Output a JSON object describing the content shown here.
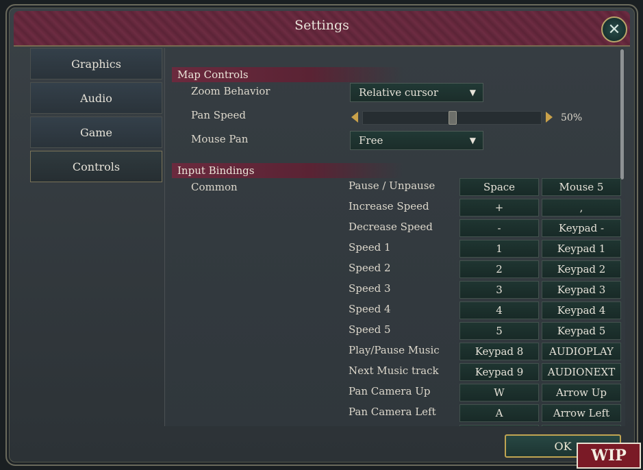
{
  "window": {
    "title": "Settings",
    "close_icon": "close-icon"
  },
  "tabs": [
    {
      "label": "Graphics"
    },
    {
      "label": "Audio"
    },
    {
      "label": "Game"
    },
    {
      "label": "Controls",
      "active": true
    }
  ],
  "map_controls": {
    "header": "Map Controls",
    "zoom_behavior": {
      "label": "Zoom Behavior",
      "value": "Relative cursor"
    },
    "pan_speed": {
      "label": "Pan Speed",
      "value": "50%",
      "fraction": 0.5
    },
    "mouse_pan": {
      "label": "Mouse Pan",
      "value": "Free"
    }
  },
  "input_bindings": {
    "header": "Input Bindings",
    "group": "Common",
    "rows": [
      {
        "action": "Pause / Unpause",
        "key1": "Space",
        "key2": "Mouse 5"
      },
      {
        "action": "Increase Speed",
        "key1": "+",
        "key2": ","
      },
      {
        "action": "Decrease Speed",
        "key1": "-",
        "key2": "Keypad -"
      },
      {
        "action": "Speed 1",
        "key1": "1",
        "key2": "Keypad 1"
      },
      {
        "action": "Speed 2",
        "key1": "2",
        "key2": "Keypad 2"
      },
      {
        "action": "Speed 3",
        "key1": "3",
        "key2": "Keypad 3"
      },
      {
        "action": "Speed 4",
        "key1": "4",
        "key2": "Keypad 4"
      },
      {
        "action": "Speed 5",
        "key1": "5",
        "key2": "Keypad 5"
      },
      {
        "action": "Play/Pause Music",
        "key1": "Keypad 8",
        "key2": "AUDIOPLAY"
      },
      {
        "action": "Next Music track",
        "key1": "Keypad 9",
        "key2": "AUDIONEXT"
      },
      {
        "action": "Pan Camera Up",
        "key1": "W",
        "key2": "Arrow Up"
      },
      {
        "action": "Pan Camera Left",
        "key1": "A",
        "key2": "Arrow Left"
      }
    ]
  },
  "footer": {
    "ok_label": "OK",
    "wip_label": "WIP"
  },
  "colors": {
    "accent_gold": "#c1a552",
    "title_maroon": "#6d2c42",
    "button_green": "#1f3531"
  }
}
